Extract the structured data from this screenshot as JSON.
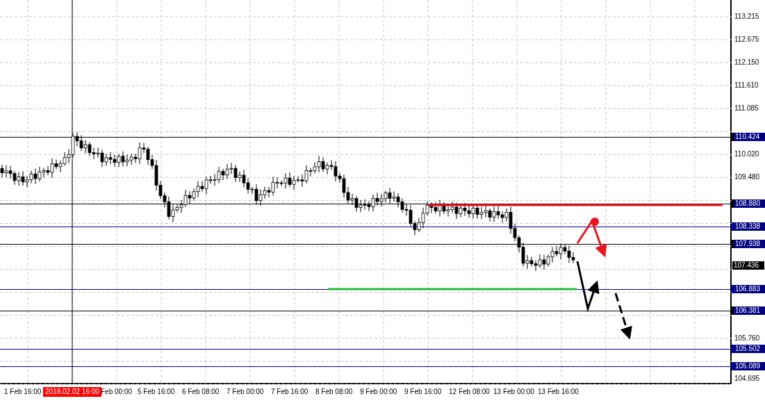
{
  "price_axis": {
    "ticks": [
      "113.215",
      "112.675",
      "112.150",
      "111.610",
      "111.085",
      "110.020",
      "109.480",
      "105.760",
      "104.695"
    ]
  },
  "time_axis": {
    "labels": [
      "1 Feb 16:00",
      "Feb 00:00",
      "5 Feb 16:00",
      "6 Feb 08:00",
      "7 Feb 00:00",
      "7 Feb 16:00",
      "8 Feb 08:00",
      "9 Feb 00:00",
      "9 Feb 16:00",
      "12 Feb 08:00",
      "13 Feb 00:00",
      "13 Feb 16:00"
    ],
    "cursor_tag": "2018.02.02 16:00"
  },
  "levels": [
    {
      "price": "110.424",
      "color": "#000000"
    },
    {
      "price": "108.880",
      "color": "#000000"
    },
    {
      "price": "108.338",
      "color": "#0000aa"
    },
    {
      "price": "107.938",
      "color": "#000000"
    },
    {
      "price": "106.883",
      "color": "#0000aa"
    },
    {
      "price": "106.381",
      "color": "#000000"
    },
    {
      "price": "105.502",
      "color": "#0000aa"
    },
    {
      "price": "105.089",
      "color": "#0000aa"
    }
  ],
  "current_price": "107.436"
}
